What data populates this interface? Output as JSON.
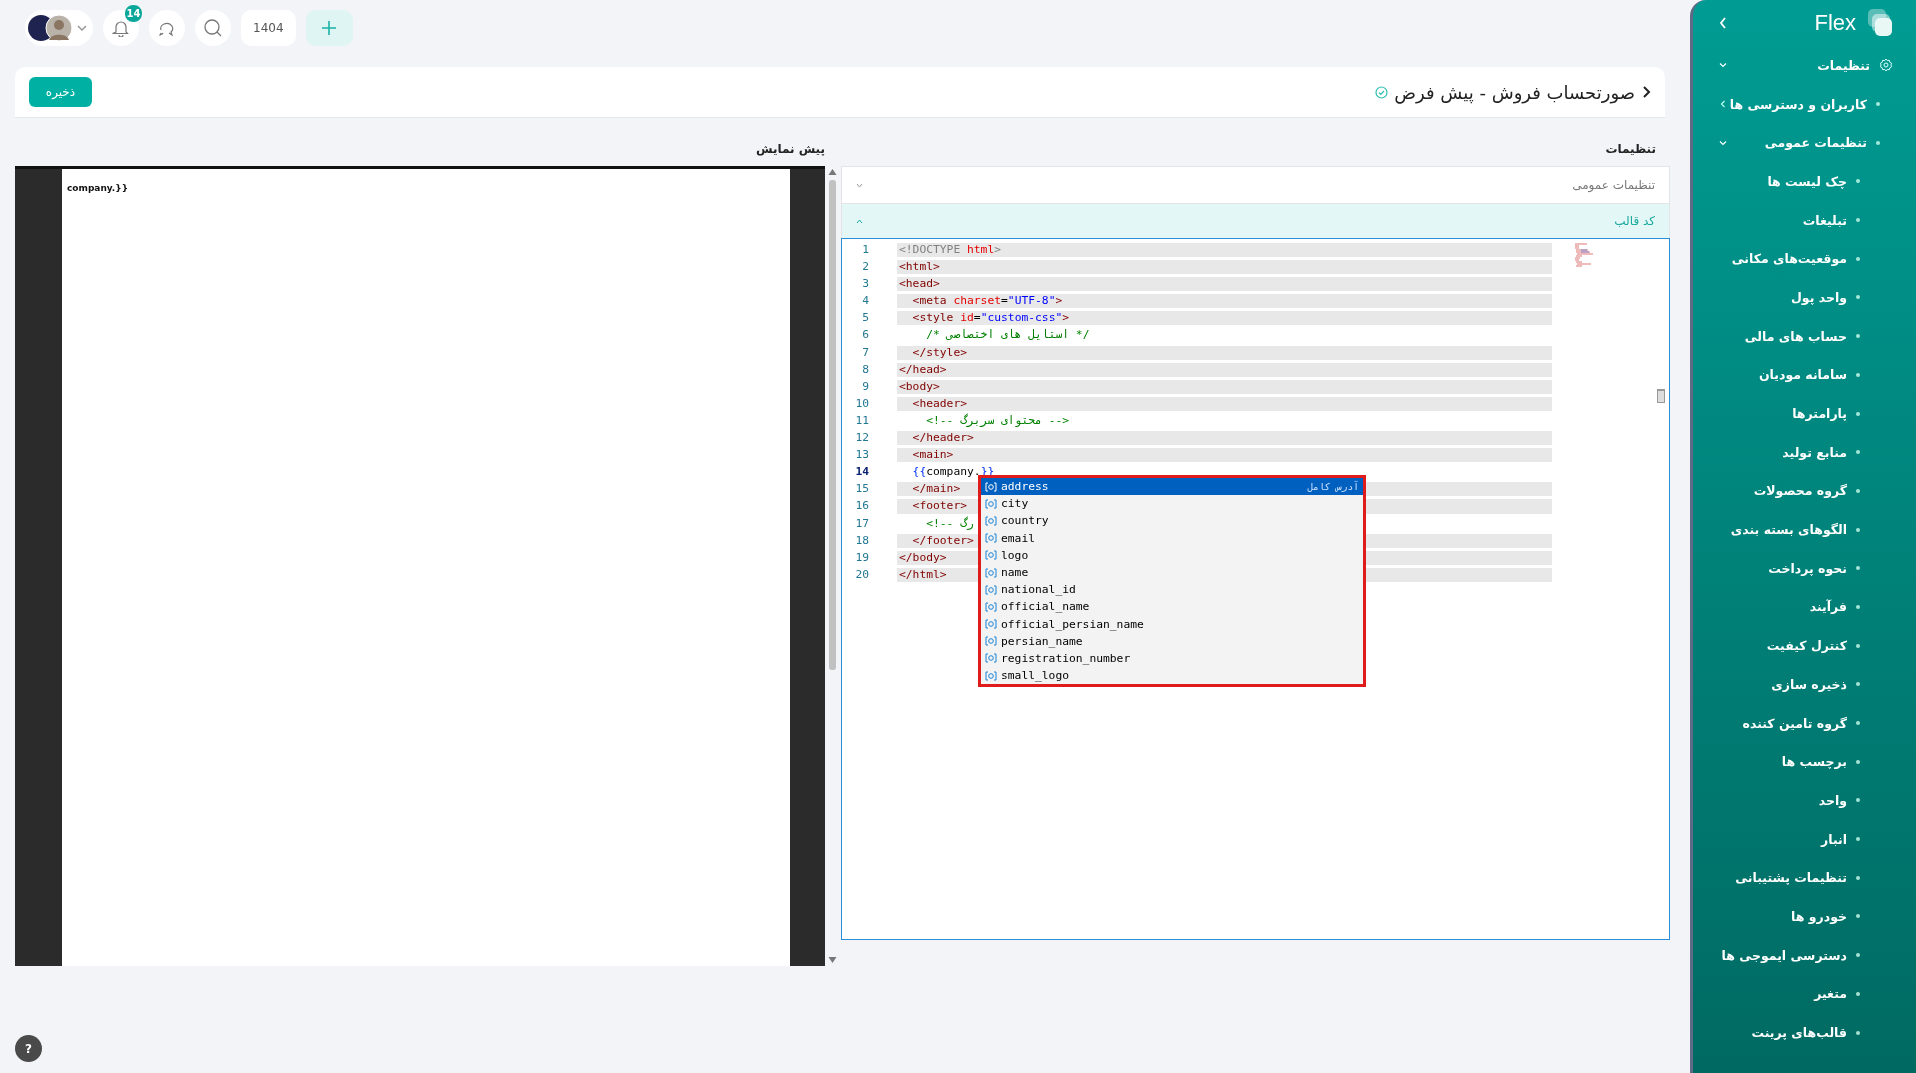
{
  "topbar": {
    "notifications_badge": "14",
    "year": "1404"
  },
  "header": {
    "title": "صورتحساب فروش - پیش فرض",
    "save_button": "ذخیره"
  },
  "preview": {
    "title": "پیش نمایش",
    "page_text": "company.}}"
  },
  "settings": {
    "title": "تنظیمات",
    "sections": [
      {
        "label": "تنظیمات عمومی",
        "expanded": false
      },
      {
        "label": "کد قالب",
        "expanded": true
      }
    ],
    "editor": {
      "lines": [
        {
          "number": "1",
          "highlighted": true,
          "active": false,
          "text": "<!DOCTYPE html>"
        },
        {
          "number": "2",
          "highlighted": true,
          "active": false,
          "text": "<html>"
        },
        {
          "number": "3",
          "highlighted": true,
          "active": false,
          "text": "<head>"
        },
        {
          "number": "4",
          "highlighted": true,
          "active": false,
          "text": "  <meta charset=\"UTF-8\">"
        },
        {
          "number": "5",
          "highlighted": true,
          "active": false,
          "text": "  <style id=\"custom-css\">"
        },
        {
          "number": "6",
          "highlighted": false,
          "active": false,
          "text": "    /* استایل های اختصاصی */"
        },
        {
          "number": "7",
          "highlighted": true,
          "active": false,
          "text": "  </style>"
        },
        {
          "number": "8",
          "highlighted": true,
          "active": false,
          "text": "</head>"
        },
        {
          "number": "9",
          "highlighted": true,
          "active": false,
          "text": "<body>"
        },
        {
          "number": "10",
          "highlighted": true,
          "active": false,
          "text": "  <header>"
        },
        {
          "number": "11",
          "highlighted": false,
          "active": false,
          "text": "    <!-- محتوای سربرگ -->"
        },
        {
          "number": "12",
          "highlighted": true,
          "active": false,
          "text": "  </header>"
        },
        {
          "number": "13",
          "highlighted": true,
          "active": false,
          "text": "  <main>"
        },
        {
          "number": "14",
          "highlighted": false,
          "active": true,
          "text": "  {{company.}}"
        },
        {
          "number": "15",
          "highlighted": true,
          "active": false,
          "text": "  </main>"
        },
        {
          "number": "16",
          "highlighted": true,
          "active": false,
          "text": "  <footer>"
        },
        {
          "number": "17",
          "highlighted": false,
          "active": false,
          "text": "    <!-- رگ"
        },
        {
          "number": "18",
          "highlighted": true,
          "active": false,
          "text": "  </footer>"
        },
        {
          "number": "19",
          "highlighted": true,
          "active": false,
          "text": "</body>"
        },
        {
          "number": "20",
          "highlighted": true,
          "active": false,
          "text": "</html>"
        }
      ],
      "suggestions": [
        {
          "label": "address",
          "detail": "آدرس کامل",
          "selected": true
        },
        {
          "label": "city",
          "selected": false
        },
        {
          "label": "country",
          "selected": false
        },
        {
          "label": "email",
          "selected": false
        },
        {
          "label": "logo",
          "selected": false
        },
        {
          "label": "name",
          "selected": false
        },
        {
          "label": "national_id",
          "selected": false
        },
        {
          "label": "official_name",
          "selected": false
        },
        {
          "label": "official_persian_name",
          "selected": false
        },
        {
          "label": "persian_name",
          "selected": false
        },
        {
          "label": "registration_number",
          "selected": false
        },
        {
          "label": "small_logo",
          "selected": false
        }
      ]
    }
  },
  "sidebar": {
    "logo": "Flex",
    "items": [
      {
        "label": "تنظیمات",
        "expanded": true,
        "children": [
          {
            "label": "کاربران و دسترسی ها",
            "expanded": false
          },
          {
            "label": "تنظیمات عمومی",
            "expanded": true,
            "children": [
              {
                "label": "چک لیست ها"
              },
              {
                "label": "تبلیغات"
              },
              {
                "label": "موقعیت‌های مکانی"
              },
              {
                "label": "واحد پول"
              },
              {
                "label": "حساب های مالی"
              },
              {
                "label": "سامانه مودیان"
              },
              {
                "label": "پارامترها"
              },
              {
                "label": "منابع تولید"
              },
              {
                "label": "گروه محصولات"
              },
              {
                "label": "الگوهای بسته بندی"
              },
              {
                "label": "نحوه پرداخت"
              },
              {
                "label": "فرآیند"
              },
              {
                "label": "کنترل کیفیت"
              },
              {
                "label": "ذخیره سازی"
              },
              {
                "label": "گروه تامین کننده"
              },
              {
                "label": "برچسب ها"
              },
              {
                "label": "واحد"
              },
              {
                "label": "انبار"
              },
              {
                "label": "تنظیمات پشتیبانی"
              },
              {
                "label": "خودرو ها"
              },
              {
                "label": "دسترسی ایموجی ها"
              },
              {
                "label": "متغیر"
              },
              {
                "label": "قالب‌های پرینت"
              }
            ]
          }
        ]
      }
    ]
  },
  "help": "?"
}
